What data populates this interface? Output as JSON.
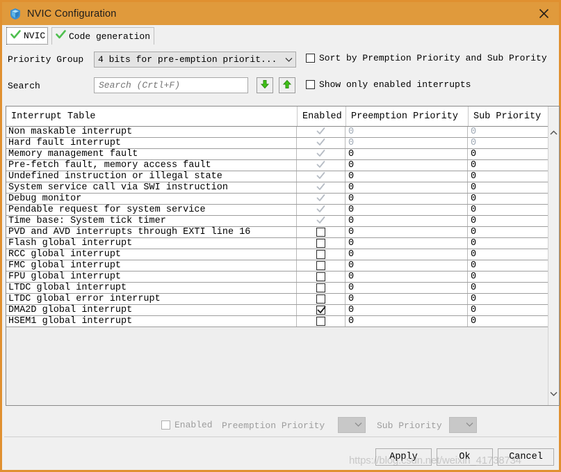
{
  "window": {
    "title": "NVIC Configuration",
    "icon": "cube-shield-icon",
    "close_label": "×",
    "titlebar_color": "#e09a3c",
    "border_color": "#e09030"
  },
  "tabs": [
    {
      "label": "NVIC",
      "icon": "green-check-icon",
      "selected": true
    },
    {
      "label": "Code generation",
      "icon": "green-check-icon",
      "selected": false
    }
  ],
  "form": {
    "priority_group_label": "Priority Group",
    "priority_group_value": "4 bits for pre-emption priorit...",
    "search_label": "Search",
    "search_value": "",
    "search_placeholder": "Search (Crtl+F)",
    "search_next_icon": "green-down-arrow-icon",
    "search_prev_icon": "green-up-arrow-icon"
  },
  "options": [
    {
      "label": "Sort by Premption Priority and Sub Prority",
      "checked": false
    },
    {
      "label": "Show only enabled interrupts",
      "checked": false
    }
  ],
  "table": {
    "columns": [
      "Interrupt Table",
      "Enabled",
      "Preemption Priority",
      "Sub Priority"
    ],
    "rows": [
      {
        "name": "Non maskable interrupt",
        "enabled": true,
        "locked": true,
        "preemption": "0",
        "sub": "0",
        "dim": true
      },
      {
        "name": "Hard fault interrupt",
        "enabled": true,
        "locked": true,
        "preemption": "0",
        "sub": "0",
        "dim": true
      },
      {
        "name": "Memory management fault",
        "enabled": true,
        "locked": true,
        "preemption": "0",
        "sub": "0",
        "dim": false
      },
      {
        "name": "Pre-fetch fault, memory access fault",
        "enabled": true,
        "locked": true,
        "preemption": "0",
        "sub": "0",
        "dim": false
      },
      {
        "name": "Undefined instruction or illegal state",
        "enabled": true,
        "locked": true,
        "preemption": "0",
        "sub": "0",
        "dim": false
      },
      {
        "name": "System service call via SWI instruction",
        "enabled": true,
        "locked": true,
        "preemption": "0",
        "sub": "0",
        "dim": false
      },
      {
        "name": "Debug monitor",
        "enabled": true,
        "locked": true,
        "preemption": "0",
        "sub": "0",
        "dim": false
      },
      {
        "name": "Pendable request for system service",
        "enabled": true,
        "locked": true,
        "preemption": "0",
        "sub": "0",
        "dim": false
      },
      {
        "name": "Time base: System tick timer",
        "enabled": true,
        "locked": true,
        "preemption": "0",
        "sub": "0",
        "dim": false
      },
      {
        "name": "PVD and AVD interrupts through EXTI line 16",
        "enabled": false,
        "locked": false,
        "preemption": "0",
        "sub": "0",
        "dim": false
      },
      {
        "name": "Flash global interrupt",
        "enabled": false,
        "locked": false,
        "preemption": "0",
        "sub": "0",
        "dim": false
      },
      {
        "name": "RCC global interrupt",
        "enabled": false,
        "locked": false,
        "preemption": "0",
        "sub": "0",
        "dim": false
      },
      {
        "name": "FMC global interrupt",
        "enabled": false,
        "locked": false,
        "preemption": "0",
        "sub": "0",
        "dim": false
      },
      {
        "name": "FPU global interrupt",
        "enabled": false,
        "locked": false,
        "preemption": "0",
        "sub": "0",
        "dim": false
      },
      {
        "name": "LTDC global interrupt",
        "enabled": false,
        "locked": false,
        "preemption": "0",
        "sub": "0",
        "dim": false
      },
      {
        "name": "LTDC global error interrupt",
        "enabled": false,
        "locked": false,
        "preemption": "0",
        "sub": "0",
        "dim": false
      },
      {
        "name": "DMA2D global interrupt",
        "enabled": true,
        "locked": false,
        "preemption": "0",
        "sub": "0",
        "dim": false
      },
      {
        "name": "HSEM1 global interrupt",
        "enabled": false,
        "locked": false,
        "preemption": "0",
        "sub": "0",
        "dim": false
      }
    ],
    "scroll_up_icon": "chevron-up-icon",
    "scroll_down_icon": "chevron-down-icon"
  },
  "detail": {
    "enabled_label": "Enabled",
    "enabled_checked": false,
    "preemption_label": "Preemption Priority",
    "preemption_value": "",
    "sub_label": "Sub Priority",
    "sub_value": ""
  },
  "buttons": {
    "apply": "Apply",
    "ok": "Ok",
    "cancel": "Cancel"
  },
  "watermark": "https://blog.csdn.net/weixin_41738734"
}
